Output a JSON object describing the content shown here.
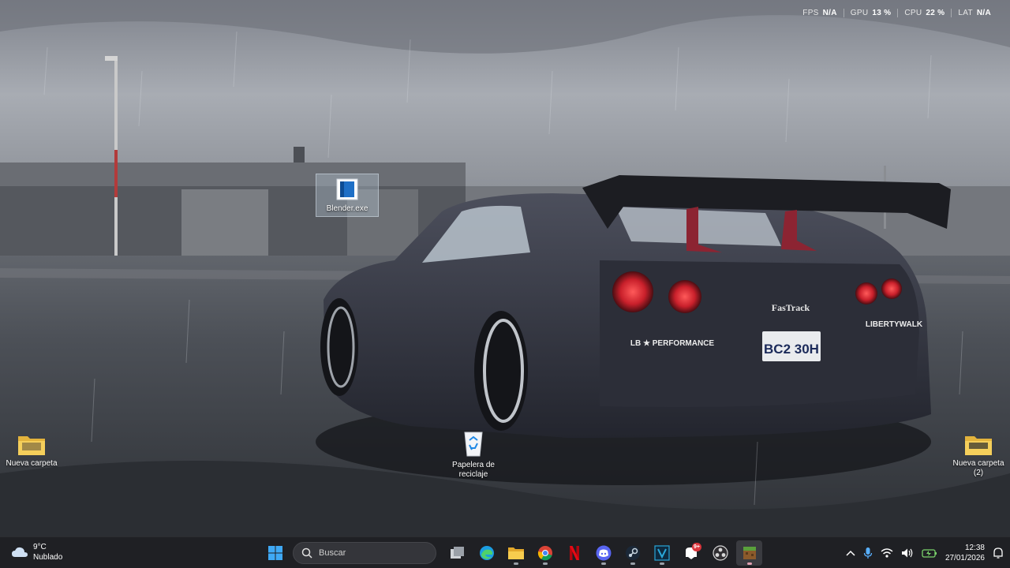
{
  "performance": {
    "fps_label": "FPS",
    "fps_value": "N/A",
    "gpu_label": "GPU",
    "gpu_value": "13 %",
    "cpu_label": "CPU",
    "cpu_value": "22 %",
    "lat_label": "LAT",
    "lat_value": "N/A"
  },
  "desktop": {
    "icons": [
      {
        "label": "Blender.exe",
        "icon": "blender-exe-icon"
      },
      {
        "label": "Nueva carpeta",
        "icon": "folder-icon"
      },
      {
        "label": "Papelera de reciclaje",
        "icon": "recycle-bin-icon"
      },
      {
        "label": "Nueva carpeta (2)",
        "icon": "folder-icon"
      }
    ]
  },
  "wallpaper": {
    "plate_text": "BC2 30H",
    "brand_text": "FasTrack",
    "badge_lb": "LB ★ PERFORMANCE",
    "badge_libertywalk": "LIBERTYWALK"
  },
  "taskbar": {
    "weather": {
      "temp": "9°C",
      "condition": "Nublado"
    },
    "search_placeholder": "Buscar",
    "apps": [
      "start-icon",
      "search-icon",
      "task-view-icon",
      "edge-icon",
      "file-explorer-icon",
      "chrome-icon",
      "netflix-icon",
      "discord-icon",
      "steam-icon",
      "visual-studio-icon",
      "notification-app-icon",
      "obs-icon",
      "minecraft-icon"
    ],
    "notification_badge": "9+",
    "clock": {
      "time": "12:38",
      "date": "27/01/2026"
    }
  },
  "colors": {
    "taskbar_bg": "#1f2024",
    "accent": "#0078d4"
  }
}
